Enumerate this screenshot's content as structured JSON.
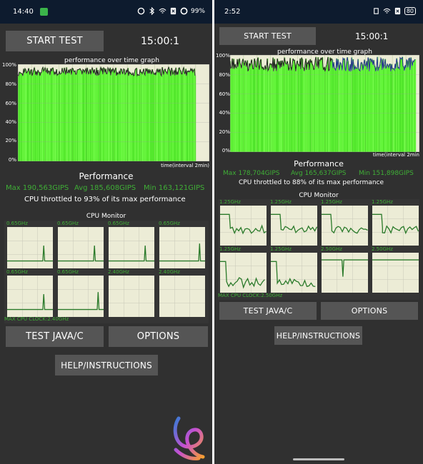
{
  "left": {
    "status": {
      "time": "14:40",
      "battery": "99%"
    },
    "start_test": "START TEST",
    "timer": "15:00:1",
    "graph_title": "performance over time graph",
    "y_ticks": [
      "100%",
      "80%",
      "60%",
      "40%",
      "20%",
      "0%"
    ],
    "x_label": "time(interval 2min)",
    "performance_title": "Performance",
    "max": "Max 190,563GIPS",
    "avg": "Avg 185,608GIPS",
    "min": "Min 163,121GIPS",
    "throttle": "CPU throttled to 93% of its max performance",
    "cpu_monitor": "CPU Monitor",
    "cores": [
      "0.65GHz",
      "0.65GHz",
      "0.65GHz",
      "0.65GHz",
      "0.65GHz",
      "0.65GHz",
      "2.40GHz",
      "2.40GHz"
    ],
    "max_cpu": "MAX CPU CLOCK:2.40GHz",
    "test_java": "TEST JAVA/C",
    "options": "OPTIONS",
    "help": "HELP/INSTRUCTIONS"
  },
  "right": {
    "status": {
      "time": "2:52",
      "battery": "80"
    },
    "start_test": "START TEST",
    "timer": "15:00:1",
    "graph_title": "performance over time graph",
    "y_ticks": [
      "100%",
      "80%",
      "60%",
      "40%",
      "20%",
      "0%"
    ],
    "x_label": "time(interval 2min",
    "performance_title": "Performance",
    "max": "Max 178,704GIPS",
    "avg": "Avg 165,637GIPS",
    "min": "Min 151,898GIPS",
    "throttle": "CPU throttled to 88% of its max performance",
    "cpu_monitor": "CPU Monitor",
    "cores": [
      "1.25GHz",
      "1.25GHz",
      "1.25GHz",
      "1.25GHz",
      "1.25GHz",
      "1.25GHz",
      "2.50GHz",
      "2.50GHz"
    ],
    "max_cpu": "MAX CPU CLOCK:2.50GHz",
    "test_java": "TEST JAVA/C",
    "options": "OPTIONS",
    "help": "HELP/INSTRUCTIONS"
  },
  "colors": {
    "background": "#303030",
    "button": "#555555",
    "graph_bg": "#ececd6",
    "bar_green": "#63f53a",
    "stat_green": "#3fae36",
    "status_bar": "#0d1b2e"
  }
}
